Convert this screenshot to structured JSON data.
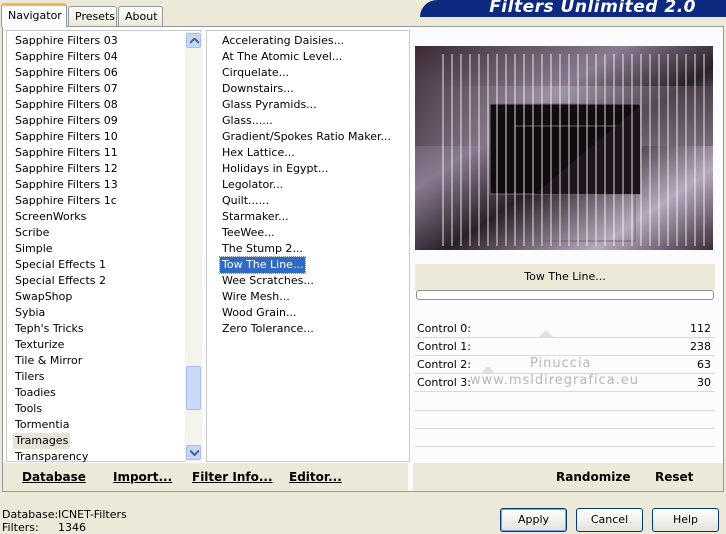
{
  "tabs": [
    {
      "label": "Navigator",
      "active": true
    },
    {
      "label": "Presets",
      "active": false
    },
    {
      "label": "About",
      "active": false
    }
  ],
  "banner": "Filters Unlimited 2.0",
  "categories": [
    "Sapphire Filters 03",
    "Sapphire Filters 04",
    "Sapphire Filters 06",
    "Sapphire Filters 07",
    "Sapphire Filters 08",
    "Sapphire Filters 09",
    "Sapphire Filters 10",
    "Sapphire Filters 11",
    "Sapphire Filters 12",
    "Sapphire Filters 13",
    "Sapphire Filters 1c",
    "ScreenWorks",
    "Scribe",
    "Simple",
    "Special Effects 1",
    "Special Effects 2",
    "SwapShop",
    "Sybia",
    "Teph's Tricks",
    "Texturize",
    "Tile & Mirror",
    "Tilers",
    "Toadies",
    "Tools",
    "Tormentia",
    "Tramages",
    "Transparency"
  ],
  "selected_category": "Tramages",
  "filters": [
    "Accelerating Daisies...",
    "At The Atomic Level...",
    "Cirquelate...",
    "Downstairs...",
    "Glass Pyramids...",
    "Glass......",
    "Gradient/Spokes Ratio Maker...",
    "Hex Lattice...",
    "Holidays in Egypt...",
    "Legolator...",
    "Quilt......",
    "Starmaker...",
    "TeeWee...",
    "The Stump 2...",
    "Tow The Line...",
    "Wee Scratches...",
    "Wire Mesh...",
    "Wood Grain...",
    "Zero Tolerance..."
  ],
  "selected_filter": "Tow The Line...",
  "preview_title": "Tow The Line...",
  "controls": [
    {
      "label": "Control 0:",
      "value": "112"
    },
    {
      "label": "Control 1:",
      "value": "238"
    },
    {
      "label": "Control 2:",
      "value": "63"
    },
    {
      "label": "Control 3:",
      "value": "30"
    }
  ],
  "watermark_line1": "Pinuccia",
  "watermark_line2": "www.msldiregrafica.eu",
  "panel_buttons": {
    "database": "Database",
    "import": "Import...",
    "filter_info": "Filter Info...",
    "editor": "Editor...",
    "randomize": "Randomize",
    "reset": "Reset"
  },
  "footer": {
    "database_label": "Database:",
    "database_value": "ICNET-Filters",
    "filters_label": "Filters:",
    "filters_value": "1346"
  },
  "dialog_buttons": {
    "apply": "Apply",
    "cancel": "Cancel",
    "help": "Help"
  },
  "colors": {
    "banner": "#0d2a80",
    "selection": "#316ac5",
    "tab_highlight": "#f7b64a"
  }
}
